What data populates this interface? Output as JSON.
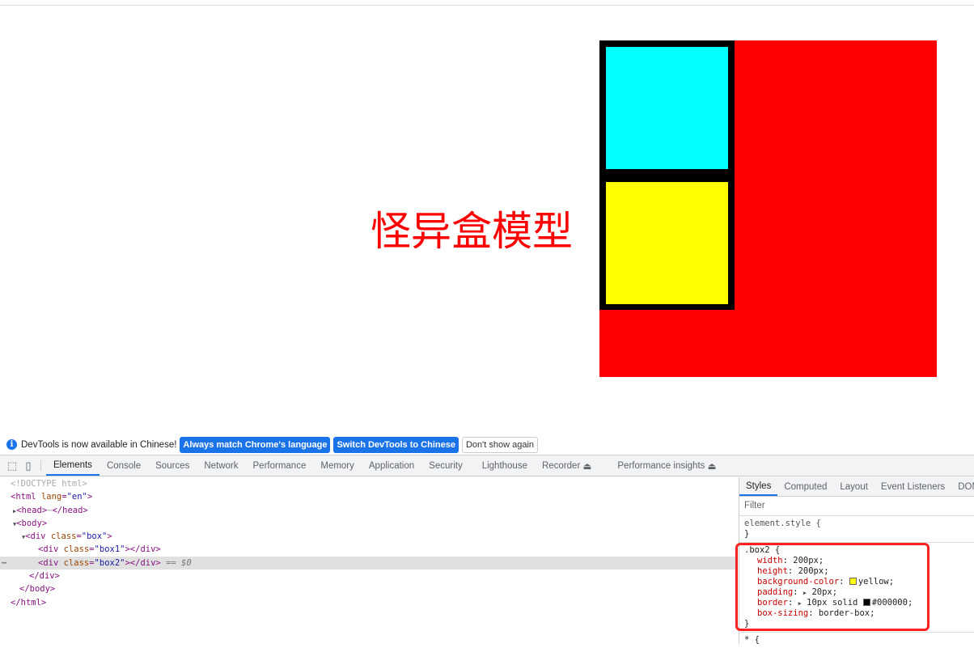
{
  "page": {
    "heading": "怪异盒模型",
    "colors": {
      "box": "#ff0000",
      "box1": "#00ffff",
      "box2": "#ffff00",
      "border": "#000000"
    }
  },
  "infobar": {
    "message": "DevTools is now available in Chinese!",
    "match_button": "Always match Chrome's language",
    "switch_button": "Switch DevTools to Chinese",
    "dismiss_button": "Don't show again"
  },
  "tabs": [
    "Elements",
    "Console",
    "Sources",
    "Network",
    "Performance",
    "Memory",
    "Application",
    "Security",
    "Lighthouse",
    "Recorder",
    "Performance insights"
  ],
  "dom": {
    "doctype": "<!DOCTYPE html>",
    "html_open": "<html",
    "lang_attr": "lang",
    "lang_val": "\"en\"",
    "head": "<head>",
    "head_close": "</head>",
    "body": "<body>",
    "div_box_attr": "class",
    "div_box_val": "\"box\"",
    "box1_val": "\"box1\"",
    "box2_val": "\"box2\"",
    "selected_marker": "== $0",
    "div_close": "</div>",
    "body_close": "</body>",
    "html_close": "</html>"
  },
  "styles": {
    "tabs": [
      "Styles",
      "Computed",
      "Layout",
      "Event Listeners",
      "DOM"
    ],
    "filter_placeholder": "Filter",
    "element_style": "element.style {",
    "selector": ".box2 {",
    "props": [
      {
        "name": "width",
        "value": "200px;"
      },
      {
        "name": "height",
        "value": "200px;"
      },
      {
        "name": "background-color",
        "value": "yellow;"
      },
      {
        "name": "padding",
        "value": "20px;"
      },
      {
        "name": "border",
        "value": "10px solid #000000;"
      },
      {
        "name": "box-sizing",
        "value": "border-box;"
      }
    ],
    "next_selector": "* {"
  }
}
